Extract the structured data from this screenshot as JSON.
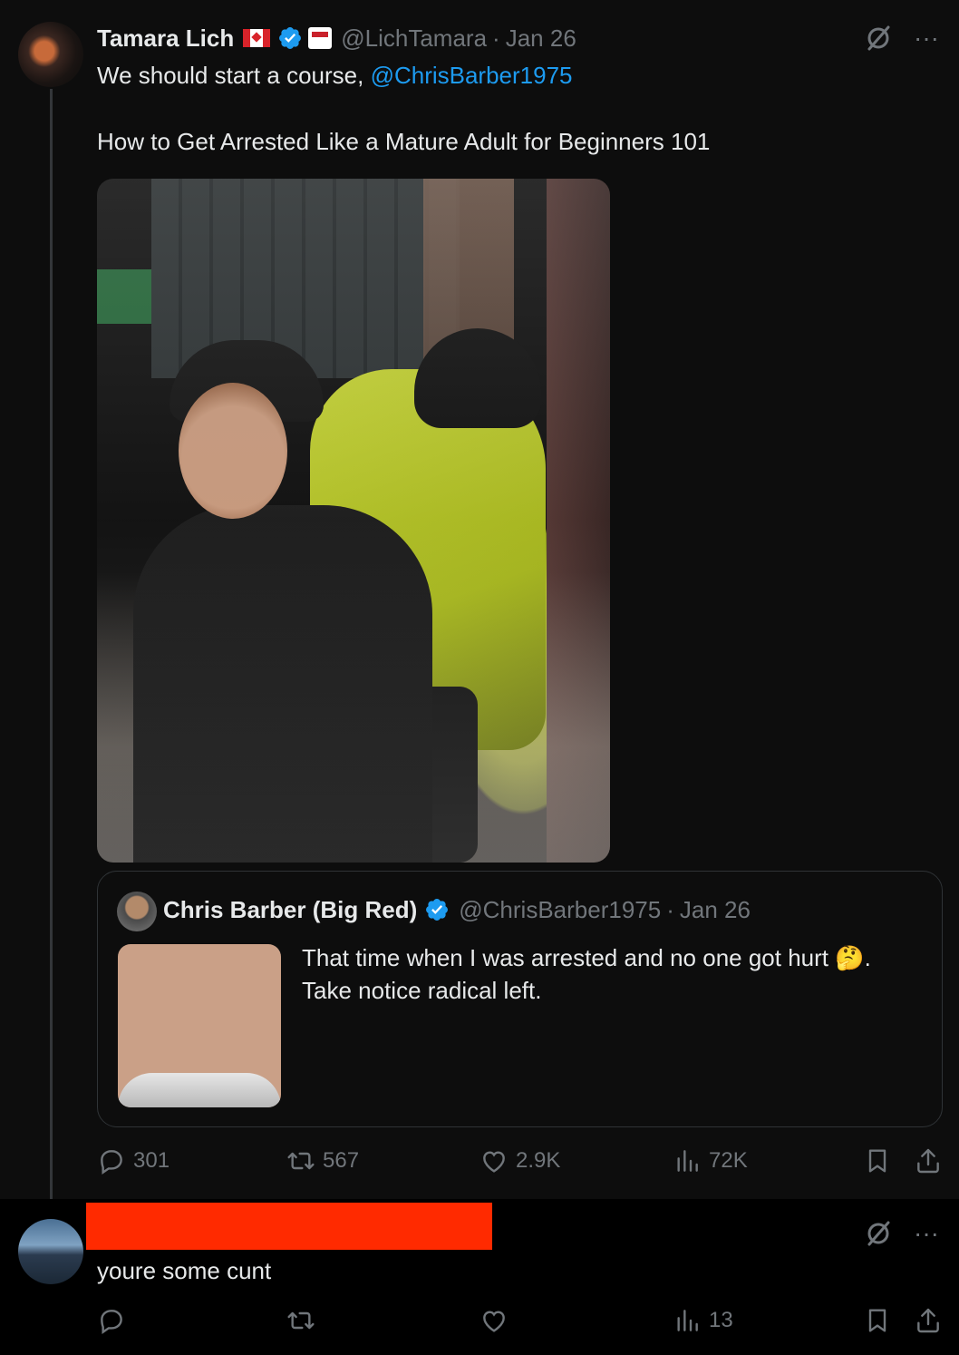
{
  "main_tweet": {
    "author_name": "Tamara Lich",
    "author_handle": "@LichTamara",
    "date": "Jan 26",
    "text_line1_prefix": "We should start a course, ",
    "text_line1_mention": "@ChrisBarber1975",
    "text_line2": "How to Get Arrested Like a Mature Adult for Beginners 101",
    "more_label": "···",
    "actions": {
      "replies": "301",
      "reposts": "567",
      "likes": "2.9K",
      "views": "72K"
    }
  },
  "quoted_tweet": {
    "author_name": "Chris Barber (Big Red)",
    "author_handle": "@ChrisBarber1975",
    "date": "Jan 26",
    "text_line1": "That time when I was arrested and no one got hurt 🤔.",
    "text_line2": "Take notice radical left."
  },
  "reply_tweet": {
    "text": "youre some cunt",
    "more_label": "···",
    "actions": {
      "views": "13"
    }
  },
  "colors": {
    "accent": "#1d9bf0",
    "muted": "#71767b",
    "redaction": "#ff2a00"
  }
}
